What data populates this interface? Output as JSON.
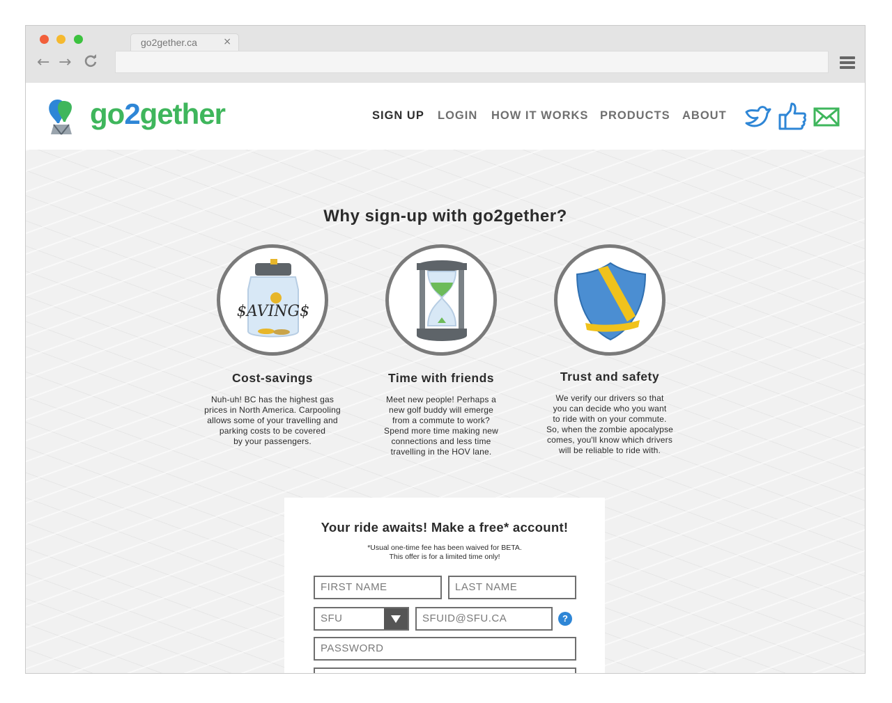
{
  "browser": {
    "tab_title": "go2gether.ca",
    "tab_close": "×",
    "back": "←",
    "forward": "→",
    "reload": "C"
  },
  "logo": {
    "part1": "go",
    "part2": "2",
    "part3": "gether"
  },
  "nav": [
    {
      "label": "SIGN UP"
    },
    {
      "label": "LOGIN"
    },
    {
      "label": "HOW IT WORKS"
    },
    {
      "label": "PRODUCTS"
    },
    {
      "label": "ABOUT"
    }
  ],
  "social": [
    "twitter-icon",
    "thumbs-up-icon",
    "mail-icon"
  ],
  "section_title": "Why sign-up with go2gether?",
  "features": [
    {
      "icon": "savings-jar-icon",
      "jar_label": "$AVING$",
      "title": "Cost-savings",
      "text": "Nuh-uh! BC has the highest gas\nprices in North America. Carpooling\nallows some of your travelling and\nparking costs to be  covered\nby your passengers."
    },
    {
      "icon": "hourglass-icon",
      "title": "Time with friends",
      "text": "Meet new people! Perhaps a\nnew golf buddy will emerge\nfrom a commute to work?\nSpend  more time making new\nconnections and less time\ntravelling in the HOV lane."
    },
    {
      "icon": "shield-icon",
      "title": "Trust and safety",
      "text": "We verify our drivers so that\nyou can decide who you want\nto ride with on your commute.\nSo, when the zombie apocalypse\ncomes, you'll  know which drivers\nwill be reliable to ride with."
    }
  ],
  "signup": {
    "title": "Your ride awaits! Make a free* account!",
    "note": "*Usual one-time fee has been waived for BETA.\nThis offer is for a limited time only!",
    "first_name": "FIRST NAME",
    "last_name": "LAST NAME",
    "school": "SFU",
    "email": "SFUID@SFU.CA",
    "help": "?",
    "password": "PASSWORD"
  },
  "colors": {
    "brand_green": "#3fb65c",
    "brand_blue": "#2e86d6",
    "text": "#2b2b2b"
  }
}
